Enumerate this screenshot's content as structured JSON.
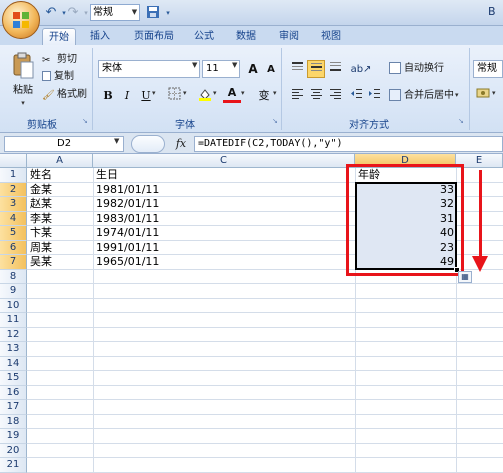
{
  "quick_access": {
    "style_value": "常规",
    "window_title": "B"
  },
  "tabs": [
    "开始",
    "插入",
    "页面布局",
    "公式",
    "数据",
    "审阅",
    "视图"
  ],
  "clipboard": {
    "paste": "粘贴",
    "cut": "剪切",
    "copy": "复制",
    "format_painter": "格式刷",
    "label": "剪贴板"
  },
  "font": {
    "name": "宋体",
    "size": "11",
    "grow": "A",
    "shrink": "A",
    "bold": "B",
    "italic": "I",
    "underline": "U",
    "font_color": "A",
    "phonetic": "变",
    "label": "字体"
  },
  "alignment": {
    "wrap_text": "自动换行",
    "merge_center": "合并后居中",
    "label": "对齐方式"
  },
  "number": {
    "format": "常规"
  },
  "formula_bar": {
    "name_box": "D2",
    "fx": "fx",
    "formula": "=DATEDIF(C2,TODAY(),\"y\")"
  },
  "columns": [
    "A",
    "C",
    "D",
    "E"
  ],
  "rows": [
    "1",
    "2",
    "3",
    "4",
    "5",
    "6",
    "7",
    "8",
    "9",
    "10",
    "11",
    "12",
    "13",
    "14",
    "15",
    "16",
    "17",
    "18",
    "19",
    "20",
    "21"
  ],
  "headers": {
    "name": "姓名",
    "birthday": "生日",
    "age": "年龄"
  },
  "table": [
    {
      "name": "金某",
      "birthday": "1981/01/11",
      "age": "33"
    },
    {
      "name": "赵某",
      "birthday": "1982/01/11",
      "age": "32"
    },
    {
      "name": "李某",
      "birthday": "1983/01/11",
      "age": "31"
    },
    {
      "name": "卞某",
      "birthday": "1974/01/11",
      "age": "40"
    },
    {
      "name": "周某",
      "birthday": "1991/01/11",
      "age": "23"
    },
    {
      "name": "吴某",
      "birthday": "1965/01/11",
      "age": "49"
    }
  ],
  "colors": {
    "annotation_red": "#e8141a",
    "selected_header": "#f3c15e",
    "ribbon_blue": "#d2e1f4"
  }
}
